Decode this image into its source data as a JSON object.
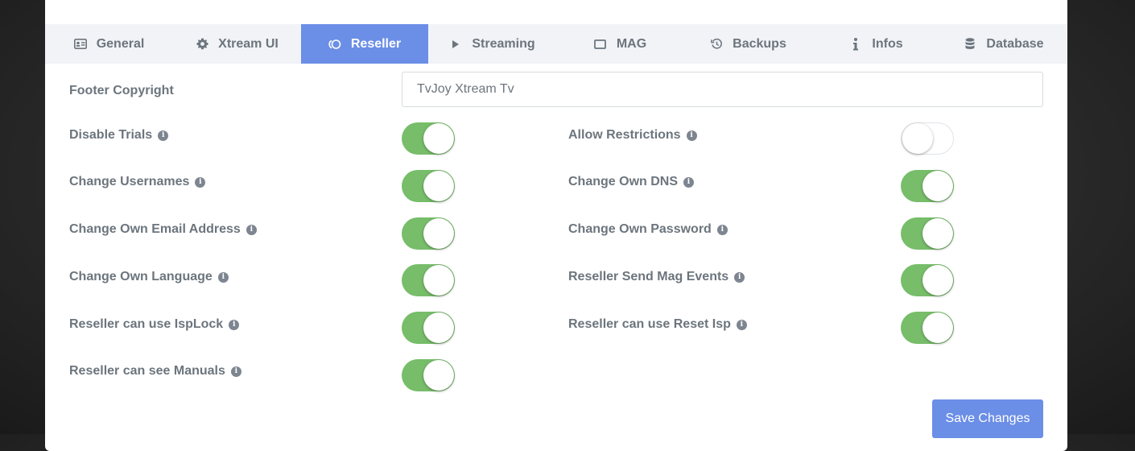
{
  "tabs": [
    {
      "label": "General",
      "icon": "id-card-icon",
      "active": false
    },
    {
      "label": "Xtream UI",
      "icon": "gear-icon",
      "active": false
    },
    {
      "label": "Reseller",
      "icon": "ring-icon",
      "active": true
    },
    {
      "label": "Streaming",
      "icon": "play-icon",
      "active": false
    },
    {
      "label": "MAG",
      "icon": "tv-box-icon",
      "active": false
    },
    {
      "label": "Backups",
      "icon": "history-icon",
      "active": false
    },
    {
      "label": "Infos",
      "icon": "info-icon",
      "active": false
    },
    {
      "label": "Database",
      "icon": "database-icon",
      "active": false
    }
  ],
  "footer": {
    "label": "Footer Copyright",
    "value": "TvJoy Xtream Tv"
  },
  "left_toggles": [
    {
      "label": "Disable Trials",
      "on": true
    },
    {
      "label": "Change Usernames",
      "on": true
    },
    {
      "label": "Change Own Email Address",
      "on": true
    },
    {
      "label": "Change Own Language",
      "on": true
    },
    {
      "label": "Reseller can use IspLock",
      "on": true
    },
    {
      "label": "Reseller can see Manuals",
      "on": true
    }
  ],
  "right_toggles": [
    {
      "label": "Allow Restrictions",
      "on": false
    },
    {
      "label": "Change Own DNS",
      "on": true
    },
    {
      "label": "Change Own Password",
      "on": true
    },
    {
      "label": "Reseller Send Mag Events",
      "on": true
    },
    {
      "label": "Reseller can use Reset Isp",
      "on": true
    }
  ],
  "save_label": "Save Changes",
  "colors": {
    "accent": "#6b8ee6",
    "toggle_on": "#77bd6a",
    "text": "#6c757d"
  }
}
